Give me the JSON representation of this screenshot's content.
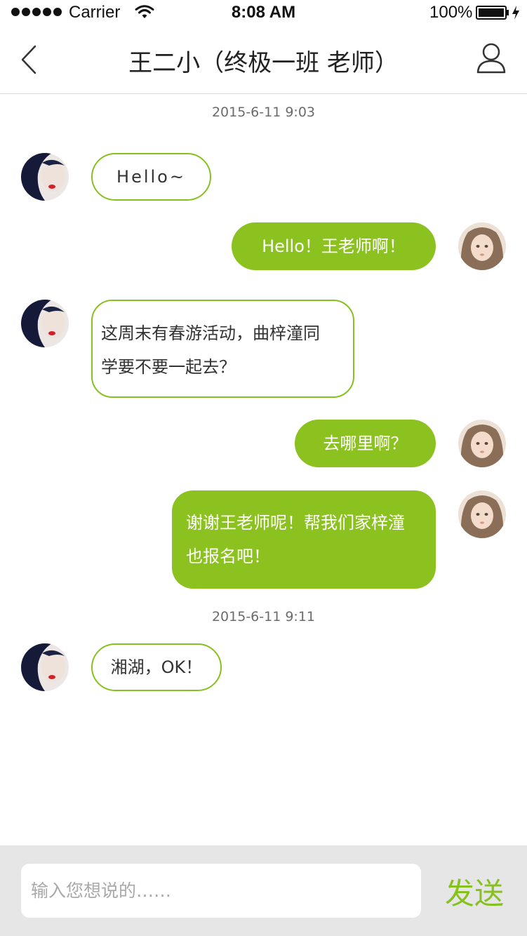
{
  "status_bar": {
    "carrier": "Carrier",
    "time": "8:08 AM",
    "battery": "100%"
  },
  "nav": {
    "title": "王二小（终极一班 老师）"
  },
  "chat": {
    "timestamps": [
      "2015-6-11 9:03",
      "2015-6-11 9:11"
    ],
    "messages": [
      {
        "from": "teacher",
        "text": "Hello~"
      },
      {
        "from": "me",
        "text": "Hello！王老师啊！"
      },
      {
        "from": "teacher",
        "lines": [
          "这周末有春游活动，曲梓潼同",
          "学要不要一起去？"
        ]
      },
      {
        "from": "me",
        "text": "去哪里啊？"
      },
      {
        "from": "me",
        "lines": [
          "谢谢王老师呢！帮我们家梓潼",
          "也报名吧！"
        ]
      },
      {
        "from": "teacher",
        "text": "湘湖，OK！"
      }
    ]
  },
  "input_bar": {
    "placeholder": "输入您想说的……",
    "value": "",
    "send_label": "发送"
  },
  "colors": {
    "accent": "#8cc21f",
    "bubble_border": "#86c11f",
    "input_bar_bg": "#e6e6e6",
    "divider": "#dedede"
  },
  "icons": [
    "back-chevron-icon",
    "profile-icon",
    "wifi-icon",
    "battery-icon",
    "charging-icon",
    "signal-dots-icon"
  ]
}
